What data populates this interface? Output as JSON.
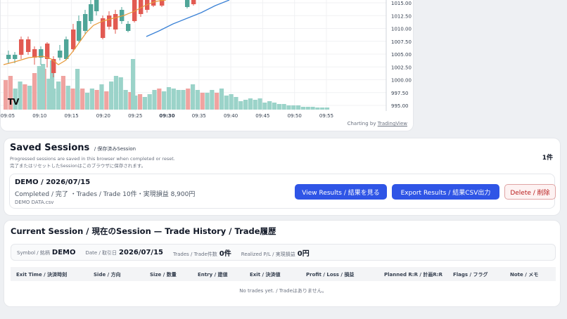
{
  "chart": {
    "price_ticks": [
      "1015.00",
      "1012.50",
      "1010.00",
      "1007.50",
      "1005.00",
      "1002.50",
      "1000.00",
      "997.50",
      "995.00"
    ],
    "time_ticks": [
      "09:05",
      "09:10",
      "09:15",
      "09:20",
      "09:25",
      "09:30",
      "09:35",
      "09:40",
      "09:45",
      "09:50",
      "09:55"
    ],
    "bold_time_tick": "09:30",
    "charting_by_label": "Charting by",
    "charting_by_link": "TradingView",
    "logo_text": "TV",
    "colors": {
      "up": "#4fa598",
      "down": "#e25a52",
      "vol_up": "#9bd3c9",
      "vol_down": "#f0a3a0",
      "ma_fast": "#e79a3a",
      "ma_slow": "#3b82d6"
    }
  },
  "saved_sessions": {
    "title": "Saved Sessions",
    "title_sub": "/ 保存済みSession",
    "desc_en": "Progressed sessions are saved in this browser when completed or reset.",
    "desc_ja": "完了またはリセットしたSessionはこのブラウザに保存されます。",
    "count": "1件",
    "session": {
      "name": "DEMO / 2026/07/15",
      "status": "Completed / 完了 ・Trades / Trade 10件・実現損益 8,900円",
      "file": "DEMO DATA.csv",
      "view_label": "View Results / 結果を見る",
      "export_label": "Export Results / 結果CSV出力",
      "delete_label": "Delete / 削除"
    }
  },
  "current_session": {
    "title": "Current Session / 現在のSession — Trade History / Trade履歴",
    "summary": {
      "symbol_label": "Symbol / 銘柄",
      "symbol_value": "DEMO",
      "date_label": "Date / 取引日",
      "date_value": "2026/07/15",
      "trades_label": "Trades / Trade件数",
      "trades_value": "0件",
      "pl_label": "Realized P/L / 実現損益",
      "pl_value": "0円"
    },
    "columns": [
      "Exit Time / 決済時刻",
      "Side / 方向",
      "Size / 数量",
      "Entry / 建値",
      "Exit / 決済値",
      "Profit / Loss / 損益",
      "Planned R:R / 計画R:R",
      "Flags / フラグ",
      "Note / メモ"
    ],
    "empty_message": "No trades yet. / Tradeはありません。"
  }
}
